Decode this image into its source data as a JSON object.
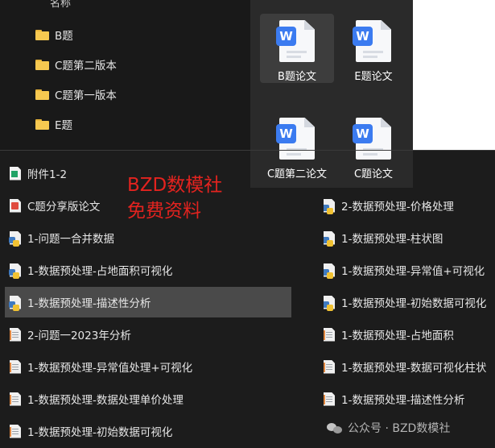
{
  "folder_panel": {
    "header": "名称",
    "folders": [
      "B题",
      "C题第二版本",
      "C题第一版本",
      "E题"
    ]
  },
  "icon_grid": {
    "tiles": [
      {
        "label": "B题论文",
        "badge": "W",
        "selected": true
      },
      {
        "label": "E题论文",
        "badge": "W",
        "selected": false
      },
      {
        "label": "C题第二论文",
        "badge": "W",
        "selected": false
      },
      {
        "label": "C题论文",
        "badge": "W",
        "selected": false
      }
    ]
  },
  "files_left": [
    {
      "name": "附件1-2",
      "icon": "xlsx-icon"
    },
    {
      "name": "C题分享版论文",
      "icon": "pdf-icon"
    },
    {
      "name": "1-问题一合并数据",
      "icon": "python-file-icon"
    },
    {
      "name": "1-数据预处理-占地面积可视化",
      "icon": "python-file-icon"
    },
    {
      "name": "1-数据预处理-描述性分析",
      "icon": "python-file-icon",
      "selected": true
    },
    {
      "name": "2-问题一2023年分析",
      "icon": "notebook-icon"
    },
    {
      "name": "1-数据预处理-异常值处理+可视化",
      "icon": "notebook-icon"
    },
    {
      "name": "1-数据预处理-数据处理单价处理",
      "icon": "notebook-icon"
    },
    {
      "name": "1-数据预处理-初始数据可视化",
      "icon": "notebook-icon"
    }
  ],
  "files_right": [
    {
      "name": "2-数据预处理-价格处理",
      "icon": "python-file-icon"
    },
    {
      "name": "1-数据预处理-柱状图",
      "icon": "python-file-icon"
    },
    {
      "name": "1-数据预处理-异常值+可视化",
      "icon": "python-file-icon"
    },
    {
      "name": "1-数据预处理-初始数据可视化",
      "icon": "python-file-icon"
    },
    {
      "name": "1-数据预处理-占地面积",
      "icon": "notebook-icon"
    },
    {
      "name": "1-数据预处理-数据可视化柱状",
      "icon": "notebook-icon"
    },
    {
      "name": "1-数据预处理-描述性分析",
      "icon": "notebook-icon"
    }
  ],
  "overlay": {
    "line1": "BZD数模社",
    "line2": "免费资料"
  },
  "watermark": "公众号 · BZD数模社",
  "colors": {
    "overlay_red": "#e3231f",
    "wps_blue": "#3b7bf0",
    "folder_yellow": "#f6c850"
  }
}
